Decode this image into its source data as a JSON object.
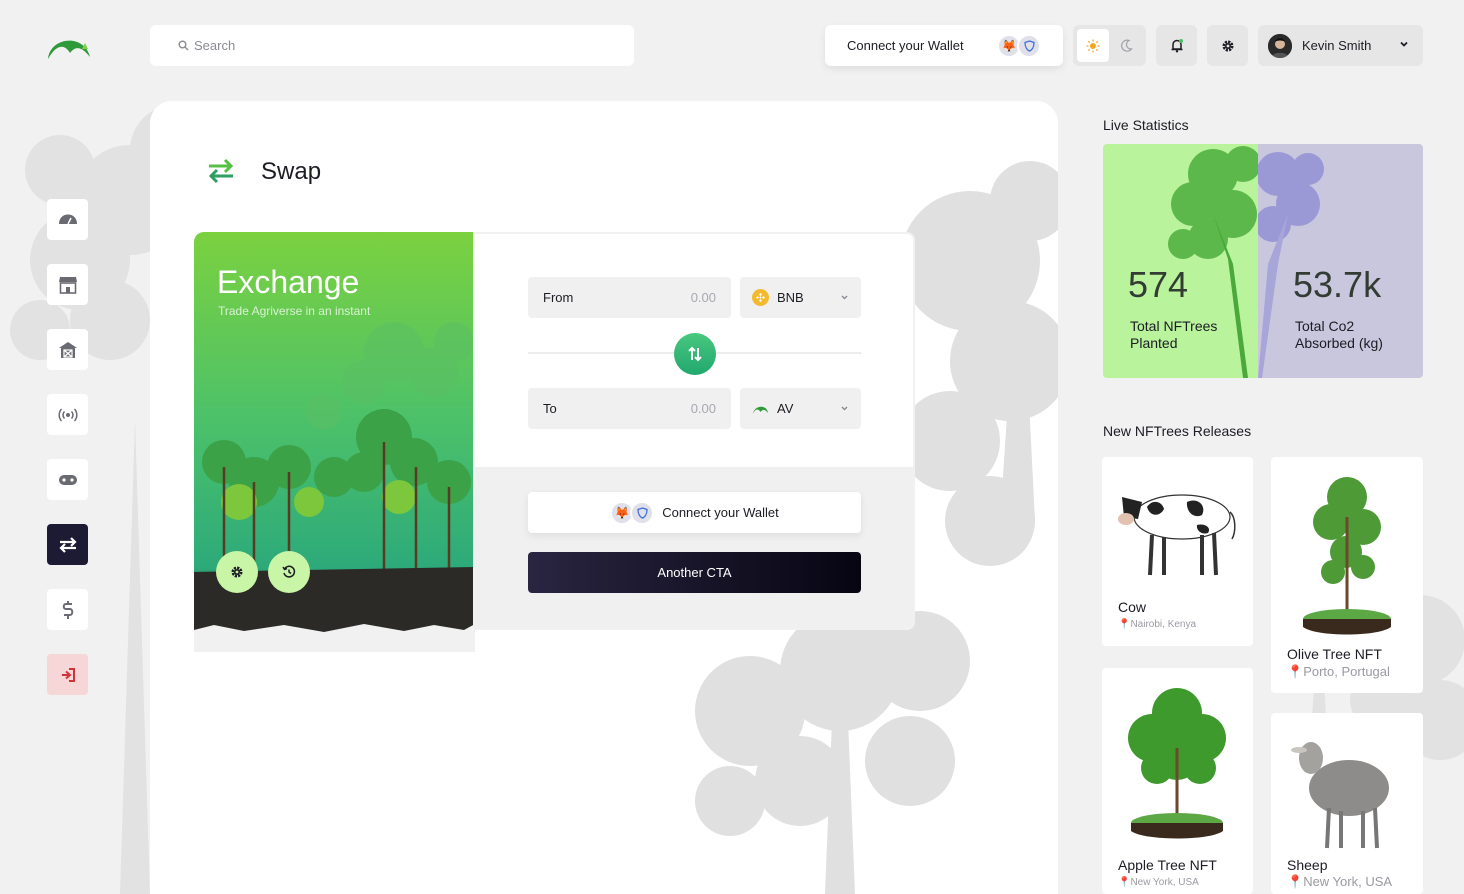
{
  "topbar": {
    "search_placeholder": "Search",
    "wallet_label": "Connect your Wallet",
    "theme_light_icon": "sun-icon",
    "theme_dark_icon": "moon-icon",
    "user_name": "Kevin Smith"
  },
  "sidebar": {
    "items": [
      {
        "name": "dashboard",
        "icon": "gauge-icon"
      },
      {
        "name": "marketplace",
        "icon": "store-icon"
      },
      {
        "name": "farm",
        "icon": "barn-icon"
      },
      {
        "name": "live",
        "icon": "broadcast-icon"
      },
      {
        "name": "games",
        "icon": "gamepad-icon"
      },
      {
        "name": "swap",
        "icon": "swap-icon",
        "active": true
      },
      {
        "name": "finance",
        "icon": "dollar-icon"
      },
      {
        "name": "logout",
        "icon": "logout-icon"
      }
    ]
  },
  "swap": {
    "title": "Swap",
    "exchange_title": "Exchange",
    "exchange_subtitle": "Trade Agriverse in an instant",
    "from_label": "From",
    "from_value": "0.00",
    "from_token": "BNB",
    "to_label": "To",
    "to_value": "0.00",
    "to_token": "AV",
    "connect_label": "Connect your Wallet",
    "cta_label": "Another CTA"
  },
  "stats": {
    "heading": "Live Statistics",
    "planted_value": "574",
    "planted_label": "Total NFTrees Planted",
    "co2_value": "53.7k",
    "co2_label": "Total Co2 Absorbed (kg)"
  },
  "releases": {
    "heading": "New NFTrees Releases",
    "items": [
      {
        "name": "Cow",
        "location": "Nairobi, Kenya"
      },
      {
        "name": "Olive Tree NFT",
        "location": "Porto, Portugal"
      },
      {
        "name": "Apple Tree NFT",
        "location": "New York, USA"
      },
      {
        "name": "Sheep",
        "location": "New York, USA"
      }
    ]
  },
  "colors": {
    "accent_green": "#4cc16a",
    "dark_cta": "#1d1a33",
    "stat_green": "#b9f39c",
    "stat_purple": "#c8c7dd"
  }
}
